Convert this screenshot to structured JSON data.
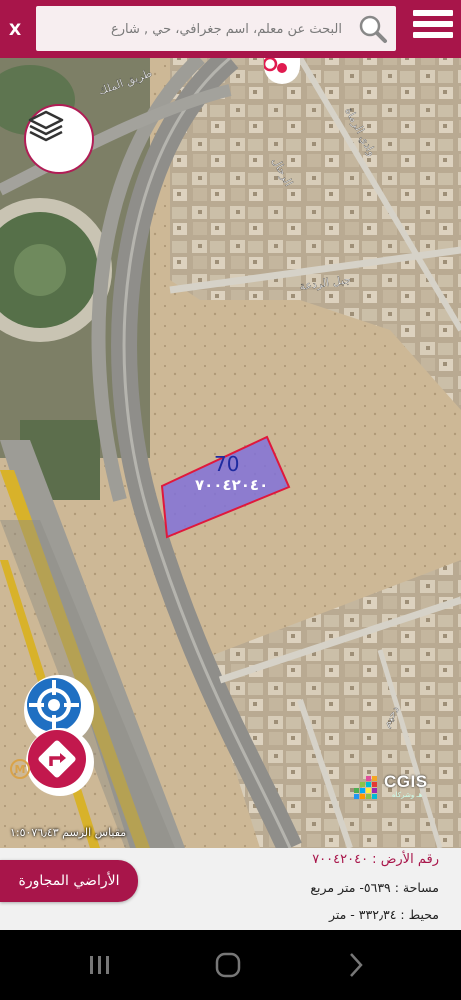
{
  "topbar": {
    "close_label": "X",
    "search_placeholder": "البحث عن معلم، اسم جغرافي، حي , شارع"
  },
  "map": {
    "streets": [
      "طريق الملك",
      "وادي الرماة",
      "الرحال",
      "جبل الردعة",
      "دحيم"
    ],
    "parcel": {
      "number_label": "70",
      "parcel_id": "٧٠٠٤٢٠٤٠"
    },
    "cgis_logo": "CGIS",
    "cgis_sub": "هـ وشركاه",
    "scale_text": "مقياس الرسم ١:٥٠٧٦٫٤٣"
  },
  "info": {
    "land_number": "رقم الأرض : ٧٠٠٤٢٠٤٠",
    "area": "مساحة  :  ٥٦٣٩- متر مربع",
    "perimeter": "محيط   :  ٣٣٢٫٣٤ - متر",
    "neighbors_button": "الأراضي المجاورة"
  },
  "colors": {
    "brand": "#a8154a",
    "parcel_fill": "#7f6fdc",
    "parcel_border": "#e0183c"
  }
}
